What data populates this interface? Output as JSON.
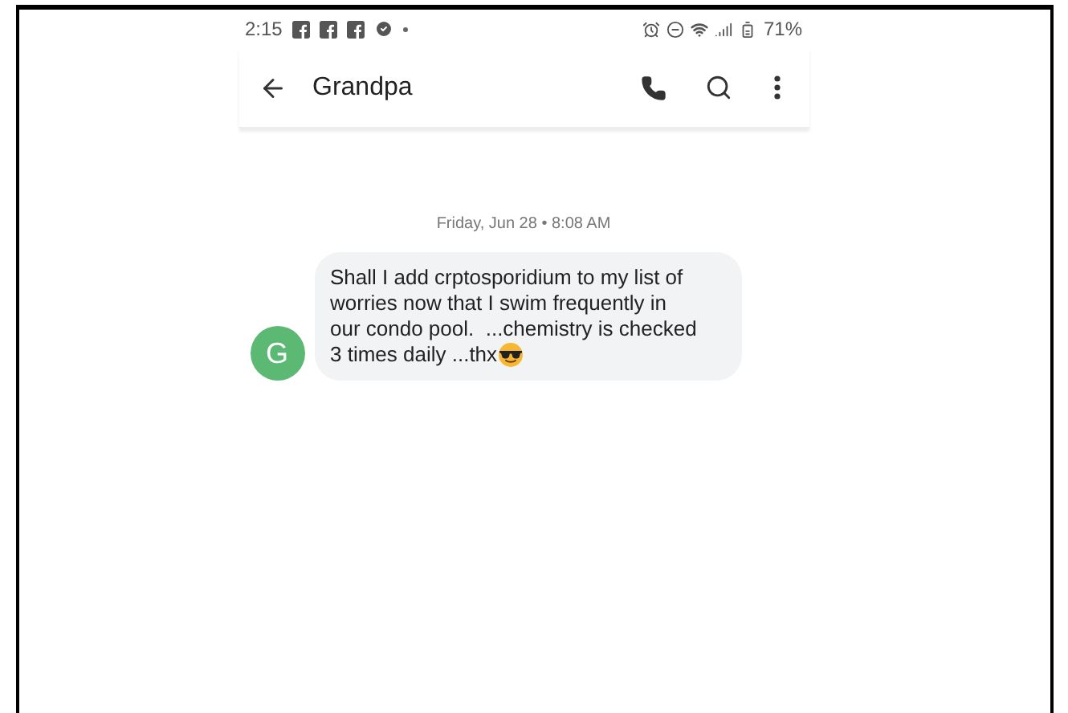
{
  "status_bar": {
    "time": "2:15",
    "battery": "71%"
  },
  "header": {
    "title": "Grandpa"
  },
  "conversation": {
    "date": "Friday, Jun 28 • 8:08 AM",
    "messages": [
      {
        "avatar": "G",
        "color": "#5bb974",
        "lines": [
          "Shall I add crptosporidium to my list of",
          "worries now that I swim frequently in",
          "our condo pool.  ...chemistry is checked",
          "3 times daily ...thx"
        ]
      }
    ]
  }
}
